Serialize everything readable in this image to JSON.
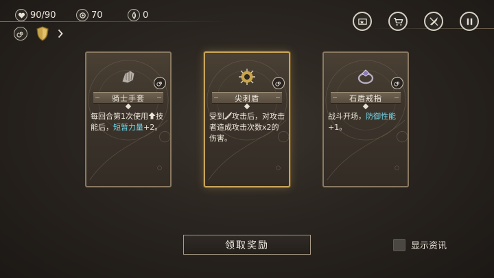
{
  "hud": {
    "hp": "90/90",
    "coins": "70",
    "essence": "0"
  },
  "cards": [
    {
      "title": "骑士手套",
      "desc_parts": [
        "每回合第1次使用",
        "技能后，",
        "短暂力量",
        "+2。"
      ],
      "selected": false
    },
    {
      "title": "尖刺盾",
      "desc_parts": [
        "受到",
        "攻击后，对攻击者造成攻击次数x2的伤害。"
      ],
      "selected": true
    },
    {
      "title": "石盾戒指",
      "desc_parts": [
        "战斗开场，",
        "防御性能",
        "+1。"
      ],
      "selected": false
    }
  ],
  "claim_button": "领取奖励",
  "show_info_label": "显示资讯",
  "colors": {
    "highlight": "#6fd6e8",
    "selected_border": "#c9a55a"
  },
  "icons": [
    "heart-icon",
    "coin-icon",
    "essence-icon",
    "spiral-icon",
    "shield-icon",
    "chevron-right-icon",
    "card-deck-icon",
    "cart-icon",
    "no-sword-icon",
    "pause-icon",
    "arrow-up-icon",
    "sword-icon"
  ]
}
